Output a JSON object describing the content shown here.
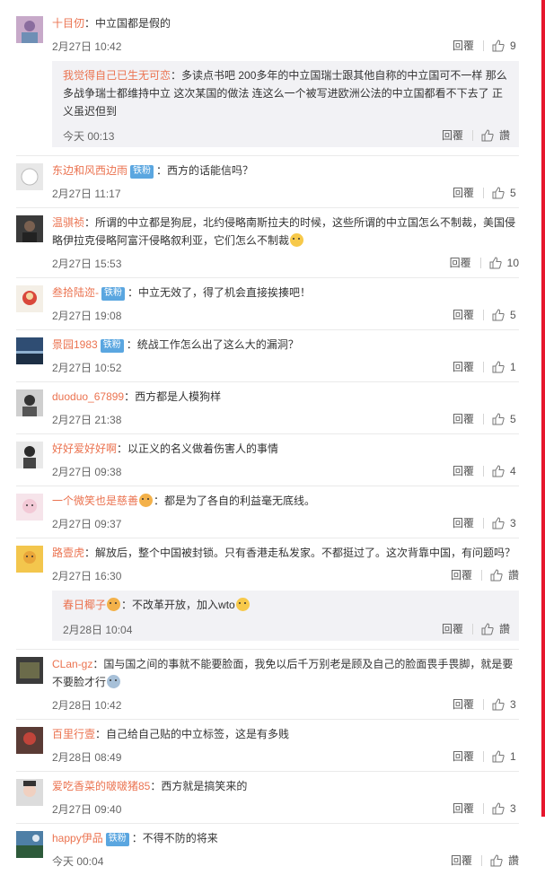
{
  "comments": [
    {
      "name": "十目仞",
      "text": "中立国都是假的",
      "time": "2月27日 10:42",
      "reply": "回覆",
      "likes": "9"
    },
    {
      "name": "我觉得自己已生无可恋",
      "text": "多读点书吧 200多年的中立国瑞士跟其他自称的中立国可不一样 那么多战争瑞士都维持中立 这次某国的做法 连这么一个被写进欧洲公法的中立国都看不下去了 正义虽迟但到",
      "time": "今天 00:13",
      "reply": "回覆",
      "likes": "讚"
    },
    {
      "name": "东边和风西边雨",
      "badge": "铁粉",
      "text": "西方的话能信吗？",
      "time": "2月27日 11:17",
      "reply": "回覆",
      "likes": "5"
    },
    {
      "name": "温骐祯",
      "text": "所谓的中立都是狗屁，北约侵略南斯拉夫的时候，这些所谓的中立国怎么不制裁，美国侵略伊拉克侵略阿富汗侵略叙利亚，它们怎么不制裁",
      "time": "2月27日 15:53",
      "reply": "回覆",
      "likes": "10"
    },
    {
      "name": "叁拾陆迩-",
      "badge": "铁粉",
      "text": "中立无效了，得了机会直接挨揍吧！",
      "time": "2月27日 19:08",
      "reply": "回覆",
      "likes": "5"
    },
    {
      "name": "景园1983",
      "badge": "铁粉",
      "text": "统战工作怎么出了这么大的漏洞？",
      "time": "2月27日 10:52",
      "reply": "回覆",
      "likes": "1"
    },
    {
      "name": "duoduo_67899",
      "text": "西方都是人模狗样",
      "time": "2月27日 21:38",
      "reply": "回覆",
      "likes": "5"
    },
    {
      "name": "好好爱好好啊",
      "text": "以正义的名义做着伤害人的事情",
      "time": "2月27日 09:38",
      "reply": "回覆",
      "likes": "4"
    },
    {
      "name": "一个微笑也是慈善",
      "text": "都是为了各自的利益毫无底线。",
      "time": "2月27日 09:37",
      "reply": "回覆",
      "likes": "3"
    },
    {
      "name": "路壹虎",
      "text": "解放后，整个中国被封锁。只有香港走私发家。不都挺过了。这次背靠中国，有问题吗？",
      "time": "2月27日 16:30",
      "reply": "回覆",
      "likes": "讚"
    },
    {
      "name": "春日椰子",
      "text": "不改革开放，加入wto",
      "time": "2月28日 10:04",
      "reply": "回覆",
      "likes": "讚"
    },
    {
      "name": "CLan-gz",
      "text": "国与国之间的事就不能要脸面，我免以后千万别老是顾及自己的脸面畏手畏脚，就是要不要脸才行",
      "time": "2月28日 10:42",
      "reply": "回覆",
      "likes": "3"
    },
    {
      "name": "百里行壹",
      "text": "自己给自己贴的中立标签，这是有多贱",
      "time": "2月28日 08:49",
      "reply": "回覆",
      "likes": "1"
    },
    {
      "name": "爱吃香菜的啵啵猪85",
      "text": "西方就是搞笑来的",
      "time": "2月27日 09:40",
      "reply": "回覆",
      "likes": "3"
    },
    {
      "name": "happy伊品",
      "badge": "铁粉",
      "text": "不得不防的将来",
      "time": "今天 00:04",
      "reply": "回覆",
      "likes": "讚"
    }
  ],
  "icons": {
    "thumb": "thumbs-up-icon",
    "emoji": "emoji-icon"
  },
  "colors": {
    "username": "#eb7350",
    "badge": "#5aa6e0",
    "accent": "#e6162d",
    "subreply_bg": "#f2f2f5"
  }
}
